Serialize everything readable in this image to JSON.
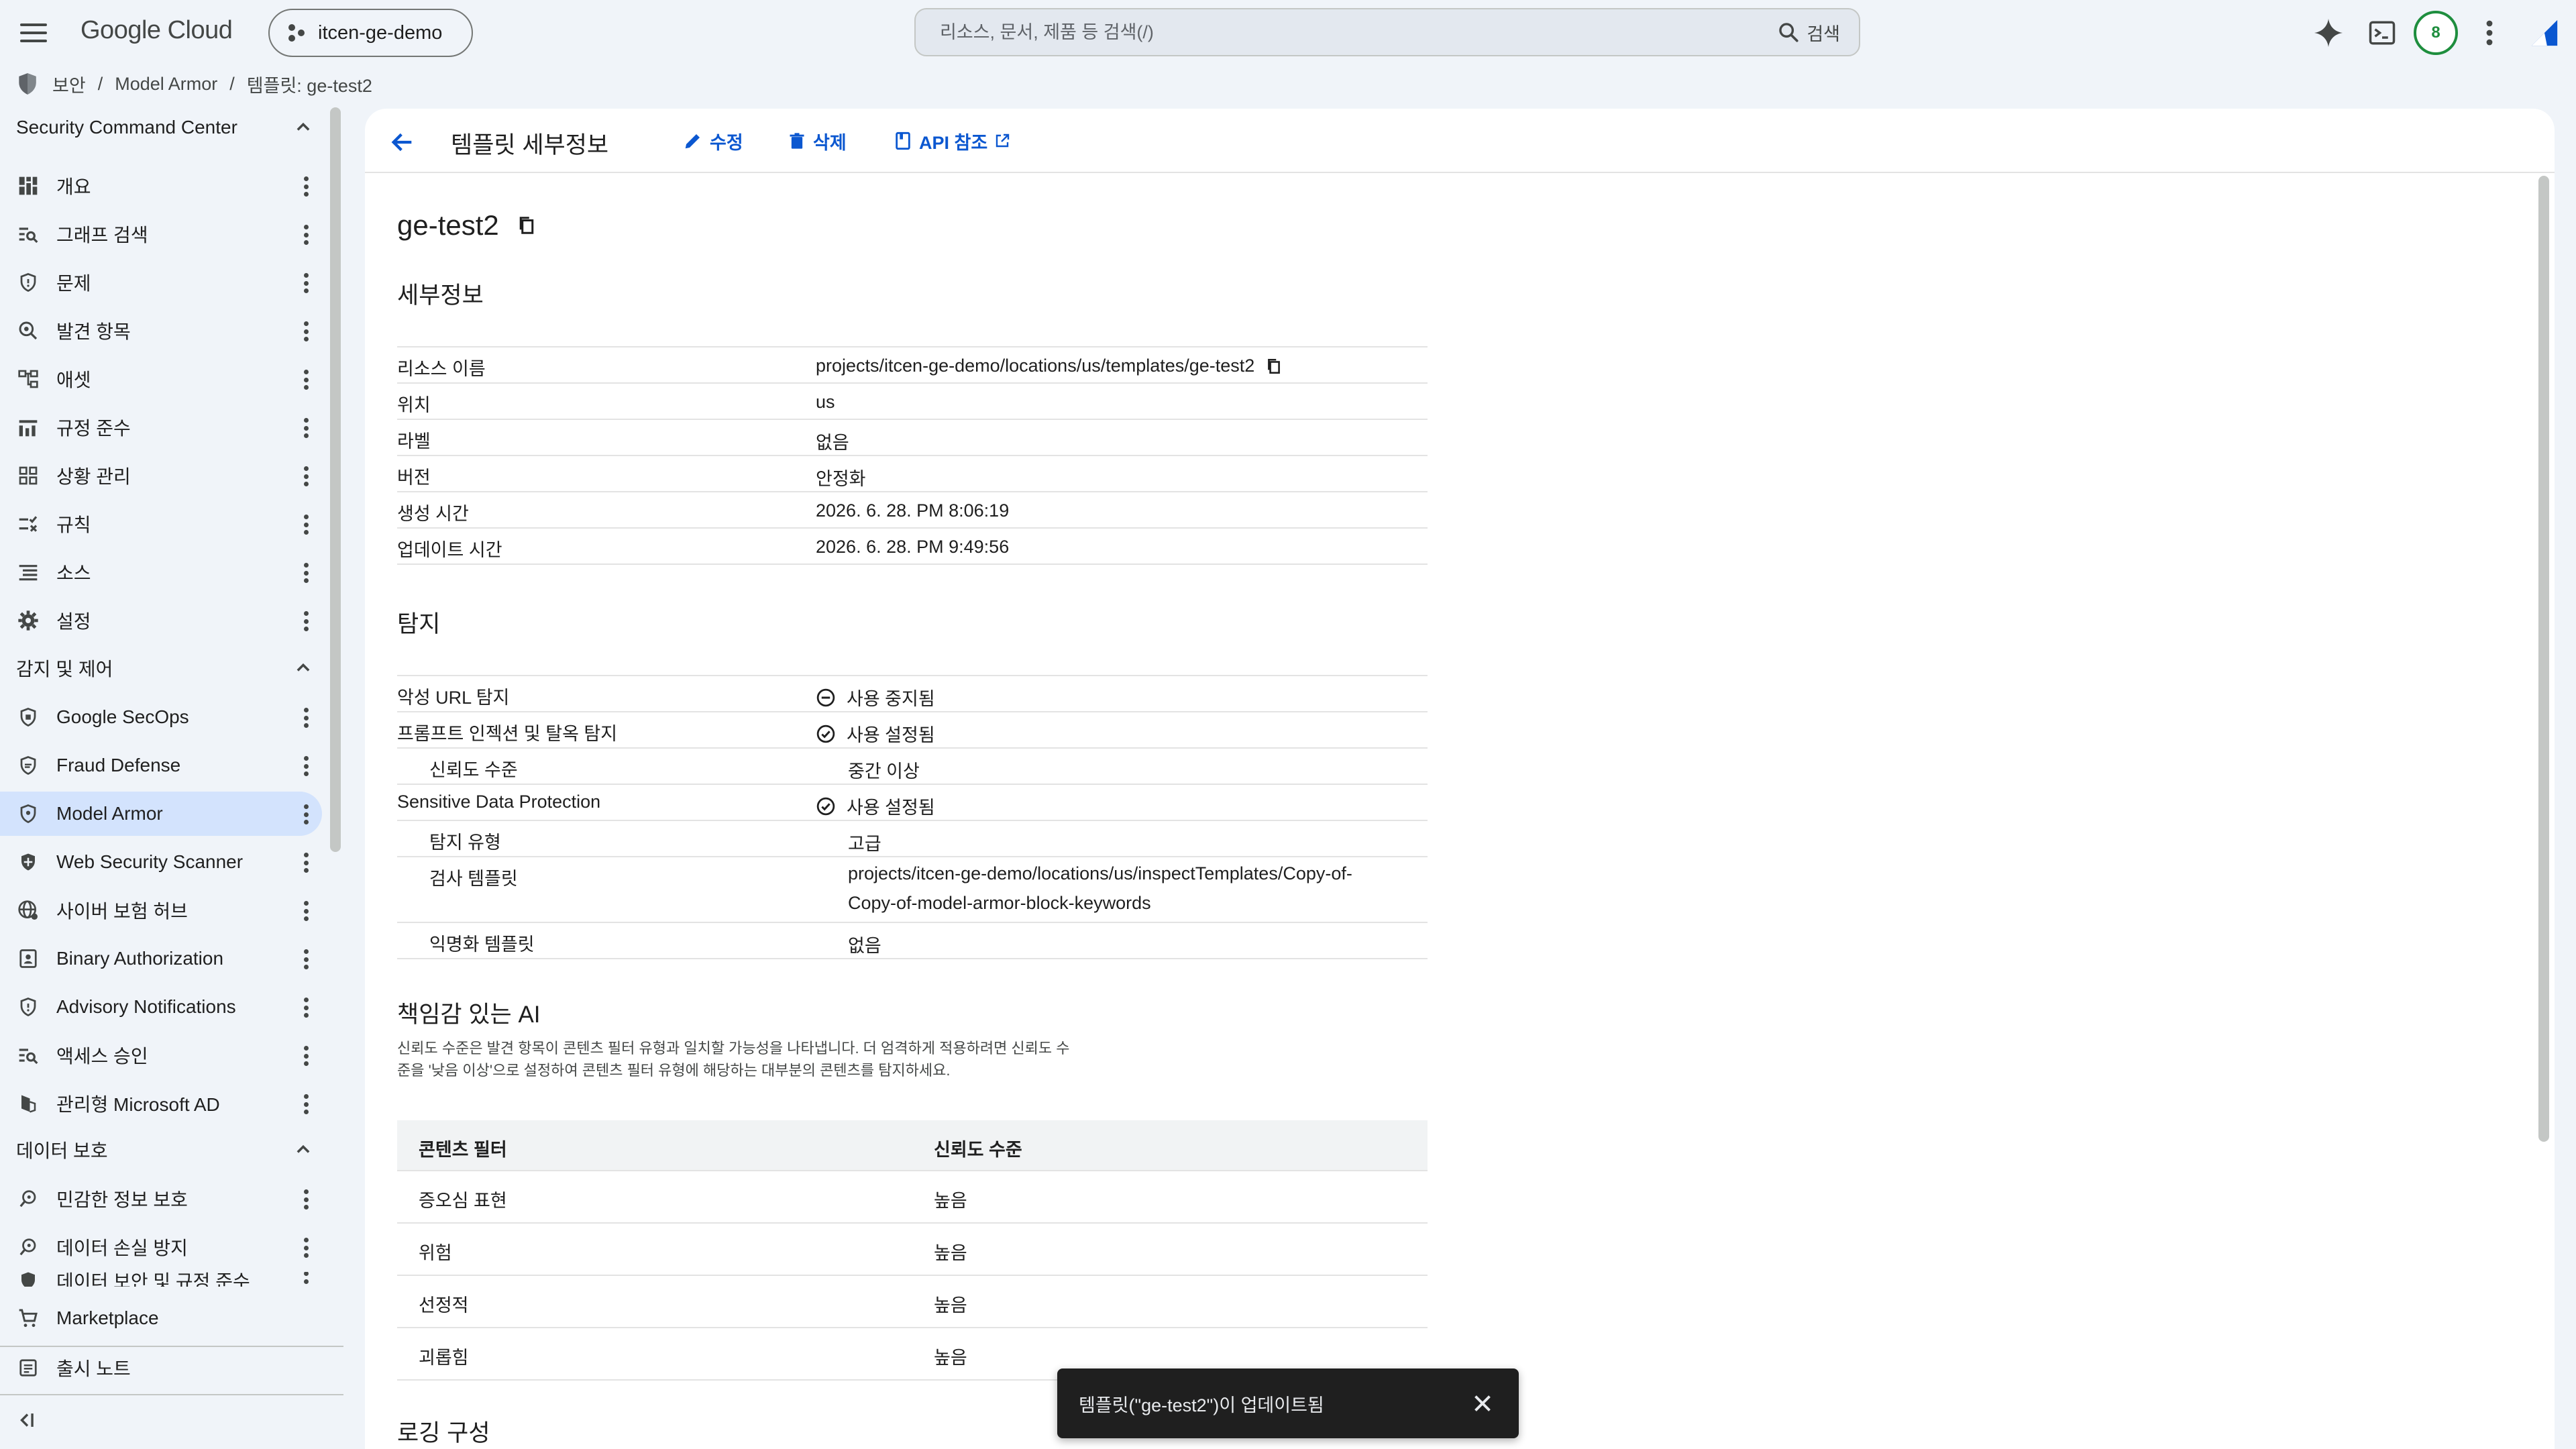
{
  "topbar": {
    "logo": "Google Cloud",
    "project": "itcen-ge-demo",
    "search_placeholder": "리소스, 문서, 제품 등 검색(/)",
    "search_button": "검색",
    "avatar_letter": "8"
  },
  "breadcrumb": [
    "보안",
    "Model Armor",
    "템플릿: ge-test2"
  ],
  "sidebar": {
    "sections": [
      {
        "title": "Security Command Center",
        "items": [
          "개요",
          "그래프 검색",
          "문제",
          "발견 항목",
          "애셋",
          "규정 준수",
          "상황 관리",
          "규칙",
          "소스",
          "설정"
        ]
      },
      {
        "title": "감지 및 제어",
        "items": [
          "Google SecOps",
          "Fraud Defense",
          "Model Armor",
          "Web Security Scanner",
          "사이버 보험 허브",
          "Binary Authorization",
          "Advisory Notifications",
          "액세스 승인",
          "관리형 Microsoft AD"
        ]
      },
      {
        "title": "데이터 보호",
        "items": [
          "민감한 정보 보호",
          "데이터 손실 방지",
          "데이터 보안 및 규정 준수"
        ]
      }
    ],
    "footer": [
      "Marketplace",
      "출시 노트"
    ]
  },
  "header": {
    "title": "템플릿 세부정보",
    "edit": "수정",
    "delete": "삭제",
    "api": "API 참조"
  },
  "template_name": "ge-test2",
  "details": {
    "heading": "세부정보",
    "rows": [
      {
        "k": "리소스 이름",
        "v": "projects/itcen-ge-demo/locations/us/templates/ge-test2"
      },
      {
        "k": "위치",
        "v": "us"
      },
      {
        "k": "라벨",
        "v": "없음"
      },
      {
        "k": "버전",
        "v": "안정화"
      },
      {
        "k": "생성 시간",
        "v": "2026. 6. 28. PM 8:06:19"
      },
      {
        "k": "업데이트 시간",
        "v": "2026. 6. 28. PM 9:49:56"
      }
    ]
  },
  "detection": {
    "heading": "탐지",
    "rows": [
      {
        "k": "악성 URL 탐지",
        "v": "사용 중지됨"
      },
      {
        "k": "프롬프트 인젝션 및 탈옥 탐지",
        "v": "사용 설정됨"
      },
      {
        "k": "신뢰도 수준",
        "v": "중간 이상"
      },
      {
        "k": "Sensitive Data Protection",
        "v": "사용 설정됨"
      },
      {
        "k": "탐지 유형",
        "v": "고급"
      },
      {
        "k": "검사 템플릿",
        "v1": "projects/itcen-ge-demo/locations/us/inspectTemplates/Copy-of-",
        "v2": "Copy-of-model-armor-block-keywords"
      },
      {
        "k": "익명화 템플릿",
        "v": "없음"
      }
    ]
  },
  "rai": {
    "heading": "책임감 있는 AI",
    "desc1": "신뢰도 수준은 발견 항목이 콘텐츠 필터 유형과 일치할 가능성을 나타냅니다. 더 엄격하게 적용하려면 신뢰도 수",
    "desc2": "준을 '낮음 이상'으로 설정하여 콘텐츠 필터 유형에 해당하는 대부분의 콘텐츠를 탐지하세요.",
    "col1": "콘텐츠 필터",
    "col2": "신뢰도 수준",
    "rows": [
      {
        "f": "증오심 표현",
        "l": "높음"
      },
      {
        "f": "위험",
        "l": "높음"
      },
      {
        "f": "선정적",
        "l": "높음"
      },
      {
        "f": "괴롭힘",
        "l": "높음"
      }
    ]
  },
  "logging_heading": "로깅 구성",
  "toast": "템플릿(\"ge-test2\")이 업데이트됨"
}
